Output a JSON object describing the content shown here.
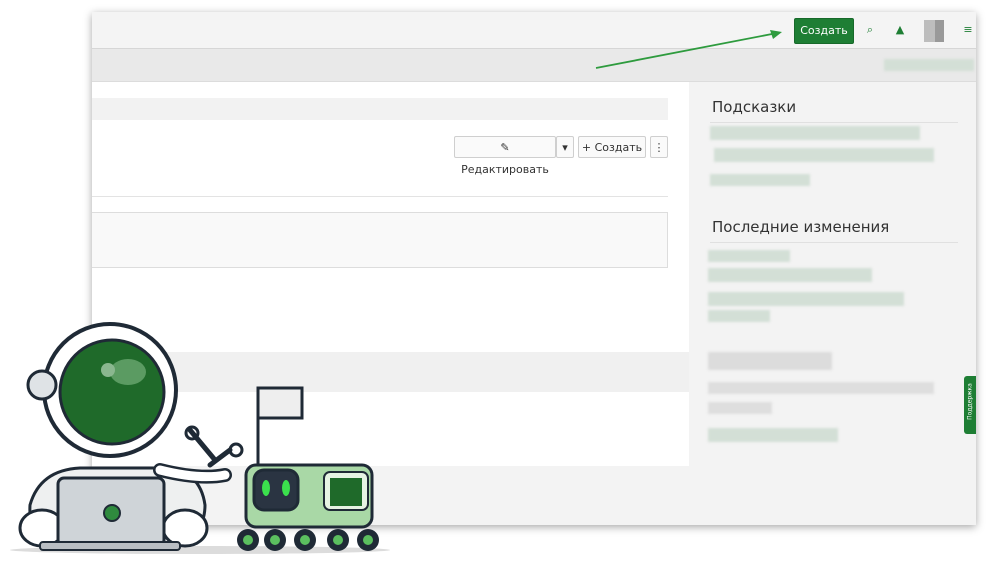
{
  "topbar": {
    "create_label": "Создать",
    "icons": [
      "search-icon",
      "bell-icon",
      "user-avatar",
      "menu-icon"
    ]
  },
  "toolbar": {
    "edit_label": "✎ Редактировать",
    "edit_dropdown": "▾",
    "create_label": "+ Создать",
    "more_label": "⋮"
  },
  "sidebar": {
    "hints_title": "Подсказки",
    "changes_title": "Последние изменения"
  },
  "feedback_tab": {
    "label": "Поддержка"
  },
  "colors": {
    "accent": "#1e7e34",
    "arrow": "#2e9b3e"
  }
}
